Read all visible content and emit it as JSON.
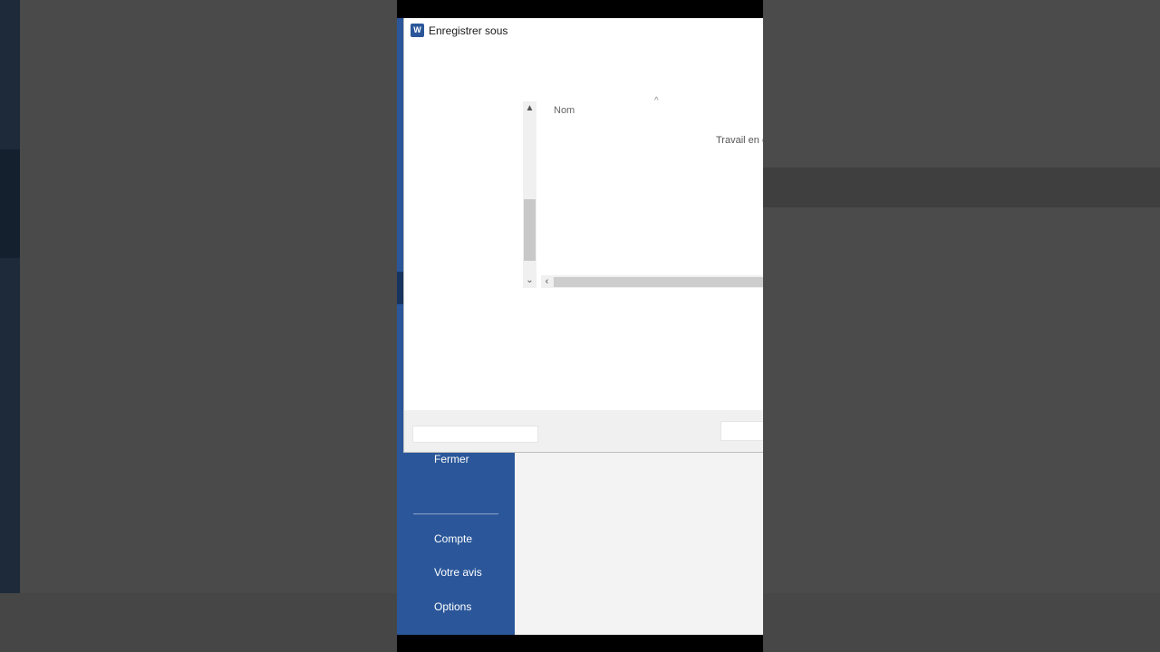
{
  "dialog": {
    "title": "Enregistrer sous",
    "app_icon_letter": "W",
    "column_header": "Nom",
    "status_text": "Travail en c"
  },
  "backstage": {
    "items": [
      {
        "label": "Fermer"
      },
      {
        "label": "Compte"
      },
      {
        "label": "Votre avis"
      },
      {
        "label": "Options"
      }
    ]
  },
  "colors": {
    "backstage_blue": "#2b579a",
    "dialog_bg": "#ffffff",
    "footer_bg": "#f0f0f0"
  },
  "icons": {
    "app": "word-app-icon",
    "sort": "chevron-up-icon",
    "scroll_up": "scroll-up-arrow-icon",
    "scroll_down": "scroll-down-arrow-icon",
    "scroll_left": "scroll-left-arrow-icon"
  }
}
